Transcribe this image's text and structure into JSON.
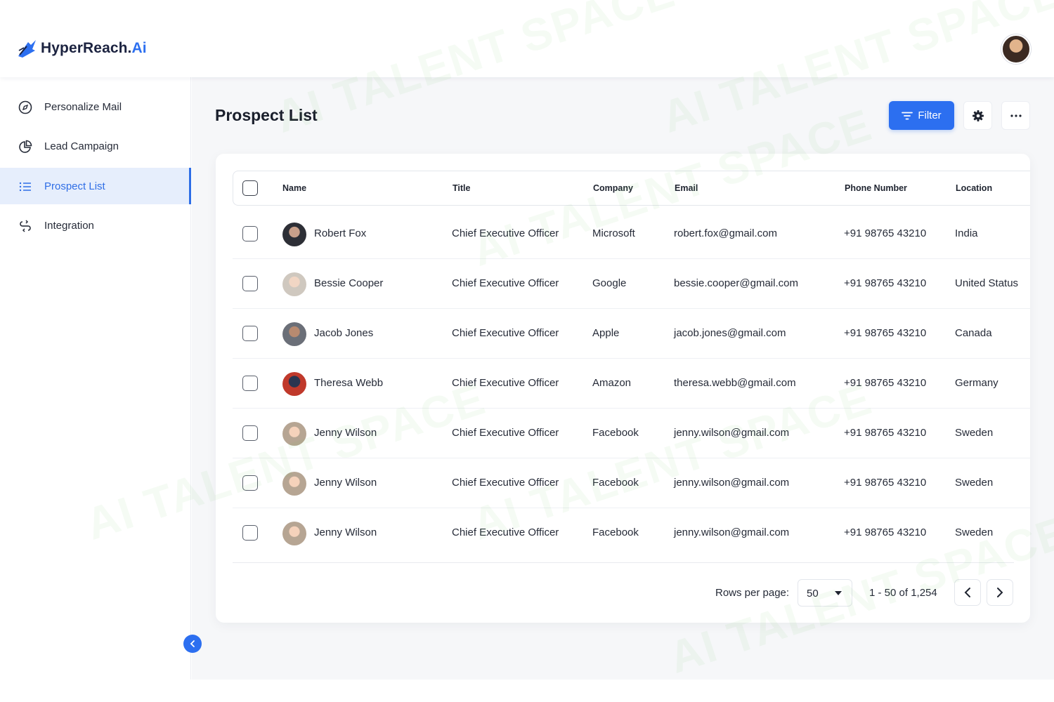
{
  "brand": {
    "name": "HyperReach.",
    "accent": "Ai",
    "color": "#2c6ff0"
  },
  "sidebar": {
    "items": [
      {
        "label": "Personalize Mail",
        "icon": "compass-icon",
        "active": false
      },
      {
        "label": "Lead Campaign",
        "icon": "pie-chart-icon",
        "active": false
      },
      {
        "label": "Prospect List",
        "icon": "list-icon",
        "active": true
      },
      {
        "label": "Integration",
        "icon": "integration-icon",
        "active": false
      }
    ]
  },
  "header": {
    "title": "Prospect List",
    "filter_label": "Filter"
  },
  "table": {
    "columns": [
      "Name",
      "Title",
      "Company",
      "Email",
      "Phone Number",
      "Location"
    ],
    "rows": [
      {
        "name": "Robert Fox",
        "title": "Chief Executive Officer",
        "company": "Microsoft",
        "email": "robert.fox@gmail.com",
        "phone": "+91 98765 43210",
        "location": "India"
      },
      {
        "name": "Bessie Cooper",
        "title": "Chief Executive Officer",
        "company": "Google",
        "email": "bessie.cooper@gmail.com",
        "phone": "+91 98765 43210",
        "location": "United Status"
      },
      {
        "name": "Jacob Jones",
        "title": "Chief Executive Officer",
        "company": "Apple",
        "email": "jacob.jones@gmail.com",
        "phone": "+91 98765 43210",
        "location": "Canada"
      },
      {
        "name": "Theresa Webb",
        "title": "Chief Executive Officer",
        "company": "Amazon",
        "email": "theresa.webb@gmail.com",
        "phone": "+91 98765 43210",
        "location": "Germany"
      },
      {
        "name": "Jenny Wilson",
        "title": "Chief Executive Officer",
        "company": "Facebook",
        "email": "jenny.wilson@gmail.com",
        "phone": "+91 98765 43210",
        "location": "Sweden"
      },
      {
        "name": "Jenny Wilson",
        "title": "Chief Executive Officer",
        "company": "Facebook",
        "email": "jenny.wilson@gmail.com",
        "phone": "+91 98765 43210",
        "location": "Sweden"
      },
      {
        "name": "Jenny Wilson",
        "title": "Chief Executive Officer",
        "company": "Facebook",
        "email": "jenny.wilson@gmail.com",
        "phone": "+91 98765 43210",
        "location": "Sweden"
      }
    ]
  },
  "pagination": {
    "rows_per_page_label": "Rows per page:",
    "rows_per_page_value": "50",
    "range": "1 - 50 of 1,254"
  },
  "watermark": "AI TALENT SPACE"
}
